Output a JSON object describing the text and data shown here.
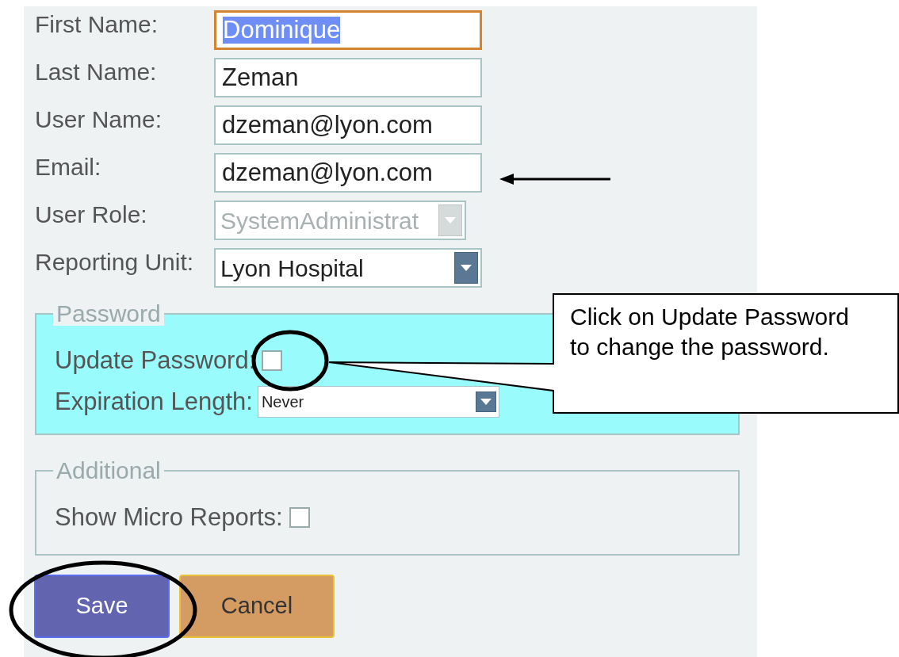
{
  "user_fields": [
    {
      "label": "First Name:",
      "kind": "text",
      "value": "Dominique",
      "focused": true
    },
    {
      "label": "Last Name:",
      "kind": "text",
      "value": "Zeman",
      "focused": false
    },
    {
      "label": "User Name:",
      "kind": "text",
      "value": "dzeman@lyon.com",
      "focused": false
    },
    {
      "label": "Email:",
      "kind": "text",
      "value": "dzeman@lyon.com",
      "focused": false
    },
    {
      "label": "User Role:",
      "kind": "select",
      "value": "SystemAdministrat",
      "disabled": true
    },
    {
      "label": "Reporting Unit:",
      "kind": "select",
      "value": "Lyon Hospital",
      "disabled": false
    }
  ],
  "password_group": {
    "legend": "Password",
    "rows": [
      {
        "label": "Update Password:",
        "kind": "checkbox",
        "checked": false
      },
      {
        "label": "Expiration Length:",
        "kind": "select",
        "value": "Never"
      }
    ]
  },
  "additional_group": {
    "legend": "Additional",
    "rows": [
      {
        "label": "Show Micro Reports:",
        "kind": "checkbox",
        "checked": false
      }
    ]
  },
  "buttons": [
    {
      "label": "Save",
      "kind": "primary"
    },
    {
      "label": "Cancel",
      "kind": "secondary"
    }
  ],
  "annotation": {
    "callout": "Click on Update Password to change the password."
  }
}
